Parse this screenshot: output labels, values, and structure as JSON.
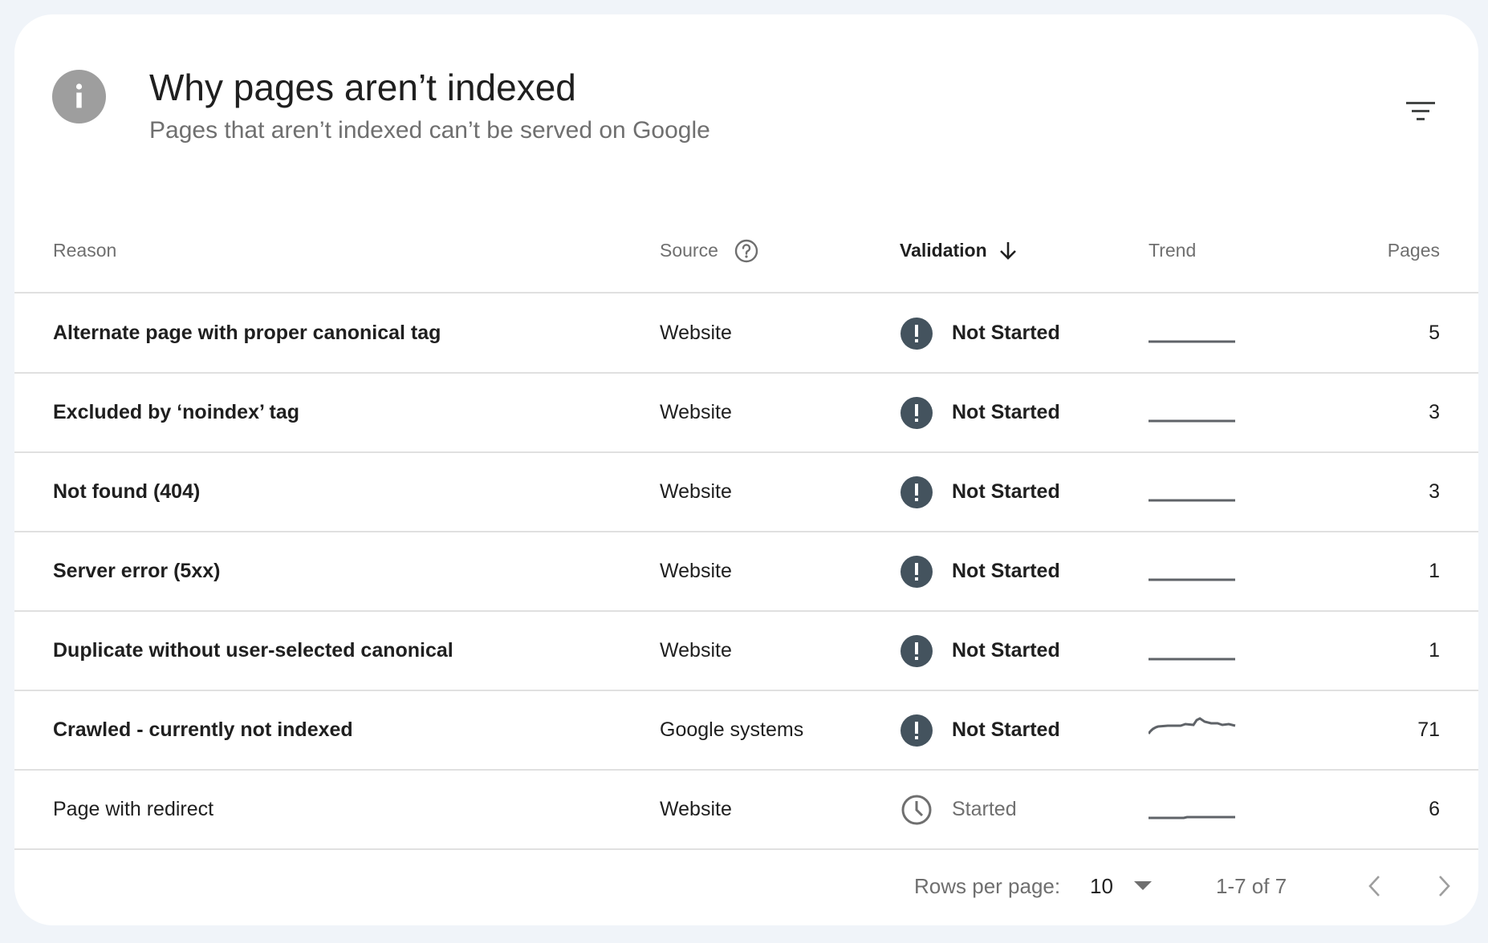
{
  "header": {
    "title": "Why pages aren’t indexed",
    "subtitle": "Pages that aren’t indexed can’t be served on Google",
    "info_icon": "info-icon",
    "filter_icon": "filter-icon"
  },
  "table": {
    "columns": {
      "reason": "Reason",
      "source": "Source",
      "validation": "Validation",
      "trend": "Trend",
      "pages": "Pages"
    },
    "sorted_by": "Validation",
    "sort_direction": "descending",
    "rows": [
      {
        "reason": "Alternate page with proper canonical tag",
        "source": "Website",
        "validation": "Not Started",
        "status_icon": "exclamation-icon",
        "trend": "flat",
        "pages": "5"
      },
      {
        "reason": "Excluded by ‘noindex’ tag",
        "source": "Website",
        "validation": "Not Started",
        "status_icon": "exclamation-icon",
        "trend": "flat",
        "pages": "3"
      },
      {
        "reason": "Not found (404)",
        "source": "Website",
        "validation": "Not Started",
        "status_icon": "exclamation-icon",
        "trend": "flat",
        "pages": "3"
      },
      {
        "reason": "Server error (5xx)",
        "source": "Website",
        "validation": "Not Started",
        "status_icon": "exclamation-icon",
        "trend": "flat",
        "pages": "1"
      },
      {
        "reason": "Duplicate without user-selected canonical",
        "source": "Website",
        "validation": "Not Started",
        "status_icon": "exclamation-icon",
        "trend": "flat",
        "pages": "1"
      },
      {
        "reason": "Crawled - currently not indexed",
        "source": "Google systems",
        "validation": "Not Started",
        "status_icon": "exclamation-icon",
        "trend": "rising",
        "pages": "71"
      },
      {
        "reason": "Page with redirect",
        "source": "Website",
        "validation": "Started",
        "status_icon": "clock-icon",
        "trend": "step",
        "pages": "6"
      }
    ]
  },
  "footer": {
    "rows_per_page_label": "Rows per page:",
    "rows_per_page_value": "10",
    "range": "1-7 of 7"
  },
  "colors": {
    "status_not_started": "#44535e",
    "status_started": "#6f6f6f",
    "trend_line": "#5f6368",
    "divider": "#e0e0e0"
  }
}
